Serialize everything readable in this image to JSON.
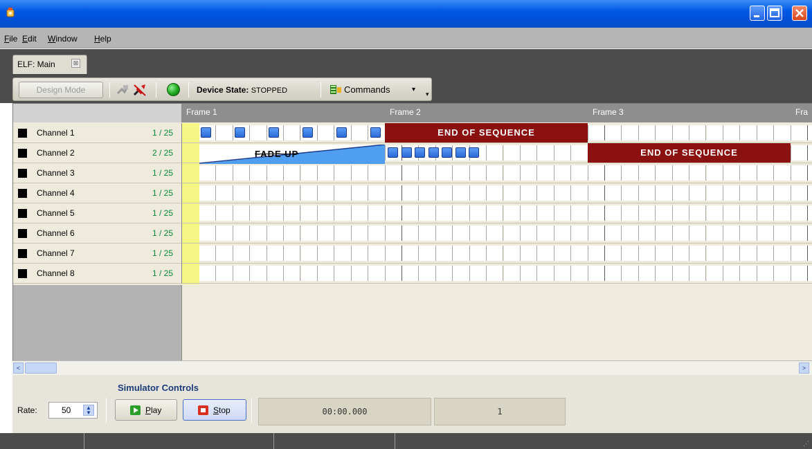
{
  "window": {
    "title": ""
  },
  "menu": [
    {
      "label": "File",
      "mnemonic": "F",
      "rest": "ile"
    },
    {
      "label": "Edit",
      "mnemonic": "E",
      "rest": "dit"
    },
    {
      "label": "Window",
      "mnemonic": "W",
      "rest": "indow"
    },
    {
      "label": "Help",
      "mnemonic": "H",
      "rest": "elp"
    }
  ],
  "doc_tab": {
    "label": "ELF: Main",
    "close": "⊠"
  },
  "toolbar": {
    "design_mode": "Design Mode",
    "device_state_label": "Device State:",
    "device_state_value": "STOPPED",
    "commands_label": "Commands",
    "commands_caret": "▾",
    "overflow": "▾",
    "led_color": "#1ea51e"
  },
  "grid": {
    "frames": [
      "Frame 1",
      "Frame 2",
      "Frame 3",
      "Fra"
    ],
    "channels": [
      {
        "name": "Channel 1",
        "count": "1 / 25"
      },
      {
        "name": "Channel 2",
        "count": "2 / 25"
      },
      {
        "name": "Channel 3",
        "count": "1 / 25"
      },
      {
        "name": "Channel 4",
        "count": "1 / 25"
      },
      {
        "name": "Channel 5",
        "count": "1 / 25"
      },
      {
        "name": "Channel 6",
        "count": "1 / 25"
      },
      {
        "name": "Channel 7",
        "count": "1 / 25"
      },
      {
        "name": "Channel 8",
        "count": "1 / 25"
      }
    ],
    "end_of_sequence": "END OF SEQUENCE",
    "fade_up": "FADE UP",
    "end_color": "#8b1010",
    "event_color": "#2b6ad8"
  },
  "scroll": {
    "left": "<",
    "right": ">"
  },
  "simulator": {
    "title": "Simulator Controls",
    "rate_label": "Rate:",
    "rate_value": "50",
    "play_mnemonic": "P",
    "play_rest": "lay",
    "stop_mnemonic": "S",
    "stop_rest": "top",
    "time": "00:00.000",
    "step": "1"
  }
}
